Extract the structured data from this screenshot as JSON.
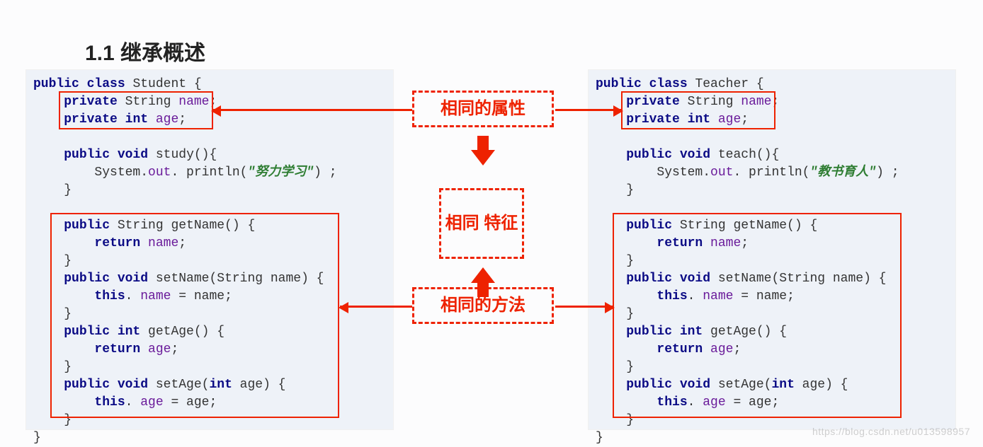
{
  "heading": "1.1 继承概述",
  "left": {
    "class_kw": "public class",
    "class_name": "Student",
    "fields": [
      {
        "mod": "private",
        "type": "String",
        "name": "name"
      },
      {
        "mod": "private",
        "type": "int",
        "name": "age"
      }
    ],
    "custom_method": {
      "sig_pre": "public void",
      "name": "study",
      "println_owner": "System.",
      "println_out": "out",
      "println_call": ". println(",
      "arg": "\"努力学习\"",
      "println_end": ") ;"
    },
    "accessors": [
      "public String getName() {",
      "    return name;",
      "}",
      "public void setName(String name) {",
      "    this. name = name;",
      "}",
      "public int getAge() {",
      "    return age;",
      "}",
      "public void setAge(int age) {",
      "    this. age = age;",
      "}"
    ]
  },
  "right": {
    "class_kw": "public class",
    "class_name": "Teacher",
    "fields": [
      {
        "mod": "private",
        "type": "String",
        "name": "name"
      },
      {
        "mod": "private",
        "type": "int",
        "name": "age"
      }
    ],
    "custom_method": {
      "sig_pre": "public void",
      "name": "teach",
      "println_owner": "System.",
      "println_out": "out",
      "println_call": ". println(",
      "arg": "\"教书育人\"",
      "println_end": ") ;"
    },
    "accessors": [
      "public String getName() {",
      "    return name;",
      "}",
      "public void setName(String name) {",
      "    this. name = name;",
      "}",
      "public int getAge() {",
      "    return age;",
      "}",
      "public void setAge(int age) {",
      "    this. age = age;",
      "}"
    ]
  },
  "center": {
    "same_attr": "相同的属性",
    "same_feat": "相同\n特征",
    "same_meth": "相同的方法"
  },
  "watermark": "https://blog.csdn.net/u013598957"
}
